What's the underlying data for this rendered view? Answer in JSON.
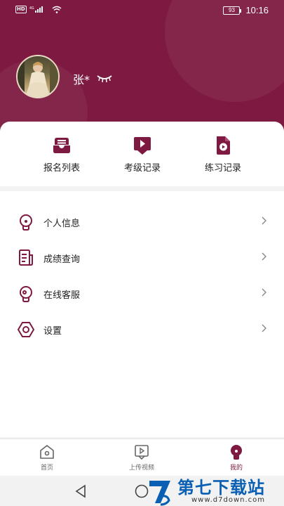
{
  "status_bar": {
    "left_indicators": "HD ⁴⁶ᴳ",
    "battery": "93",
    "time": "10:16"
  },
  "profile": {
    "name": "张*"
  },
  "quick_actions": [
    {
      "label": "报名列表",
      "icon": "inbox-icon"
    },
    {
      "label": "考级记录",
      "icon": "play-box-icon"
    },
    {
      "label": "练习记录",
      "icon": "video-file-icon"
    }
  ],
  "menu": [
    {
      "label": "个人信息",
      "icon": "lightbulb-icon"
    },
    {
      "label": "成绩查询",
      "icon": "document-icon"
    },
    {
      "label": "在线客服",
      "icon": "support-bulb-icon"
    },
    {
      "label": "设置",
      "icon": "hexagon-settings-icon"
    }
  ],
  "tabs": [
    {
      "label": "首页",
      "icon": "home-icon",
      "active": false
    },
    {
      "label": "上传视频",
      "icon": "upload-video-icon",
      "active": false
    },
    {
      "label": "我的",
      "icon": "profile-bulb-icon",
      "active": true
    }
  ],
  "watermark": {
    "title": "第七下载站",
    "url": "www.d7down.com"
  },
  "colors": {
    "accent": "#7e1a41",
    "background": "#f2f2f2",
    "card": "#ffffff"
  }
}
